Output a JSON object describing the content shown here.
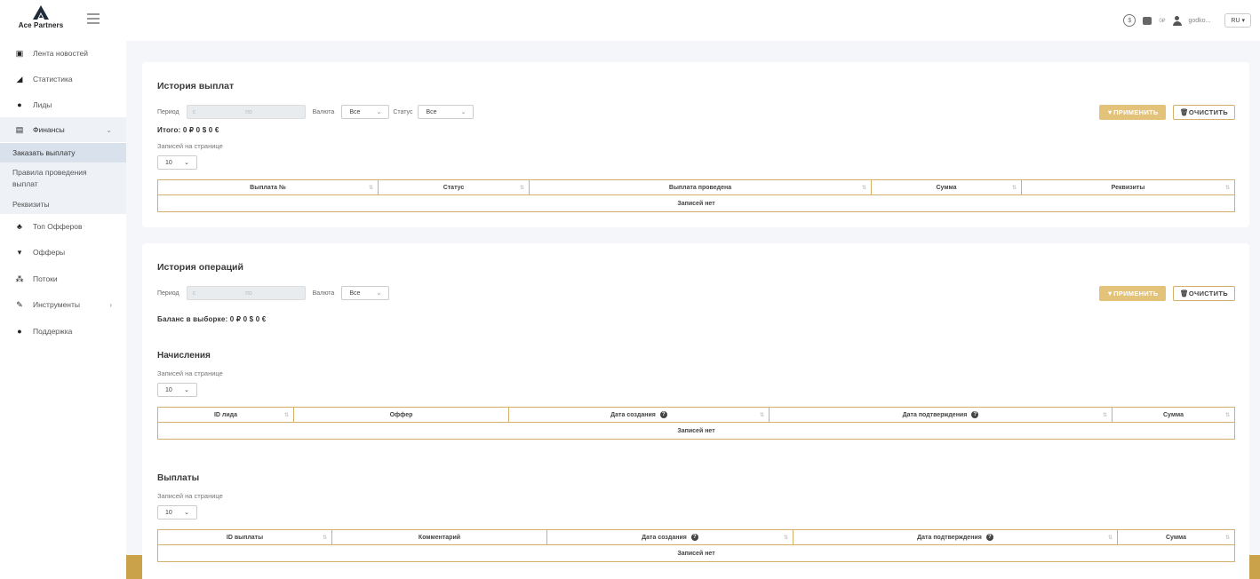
{
  "header": {
    "logo_text": "Ace Partners",
    "balance_label": "0₽",
    "username": "godko...",
    "lang": "RU ▾"
  },
  "sidebar": {
    "items": [
      {
        "label": "Лента новостей",
        "icon": "news-icon"
      },
      {
        "label": "Статистика",
        "icon": "chart-icon"
      },
      {
        "label": "Лиды",
        "icon": "check-circle-icon"
      },
      {
        "label": "Финансы",
        "icon": "money-icon"
      },
      {
        "label": "Топ Офферов",
        "icon": "trophy-icon"
      },
      {
        "label": "Офферы",
        "icon": "cart-icon"
      },
      {
        "label": "Потоки",
        "icon": "sitemap-icon"
      },
      {
        "label": "Инструменты",
        "icon": "wrench-icon"
      },
      {
        "label": "Поддержка",
        "icon": "chat-icon"
      }
    ],
    "finance_sub": [
      {
        "label": "Заказать выплату"
      },
      {
        "label": "Правила проведения выплат"
      },
      {
        "label": "Реквизиты"
      }
    ]
  },
  "common": {
    "period_label": "Период",
    "from_placeholder": "с",
    "to_placeholder": "по",
    "currency_label": "Валюта",
    "status_label": "Статус",
    "all_option": "Все",
    "apply_label": "ПРИМЕНИТЬ",
    "clear_label": "ОЧИСТИТЬ",
    "rpp_label": "Записей на странице",
    "rpp_value": "10",
    "empty": "Записей нет"
  },
  "payout_history": {
    "title": "История выплат",
    "total": "Итого:  0 ₽   0 $   0 €",
    "columns": [
      "Выплата №",
      "Статус",
      "Выплата проведена",
      "Сумма",
      "Реквизиты"
    ]
  },
  "operations_history": {
    "title": "История операций",
    "balance": "Баланс в выборке:  0 ₽   0 $   0 €",
    "accruals": {
      "title": "Начисления",
      "columns": [
        "ID лида",
        "Оффер",
        "Дата создания",
        "Дата подтверждения",
        "Сумма"
      ]
    },
    "payouts": {
      "title": "Выплаты",
      "columns": [
        "ID выплаты",
        "Комментарий",
        "Дата создания",
        "Дата подтверждения",
        "Сумма"
      ]
    }
  }
}
